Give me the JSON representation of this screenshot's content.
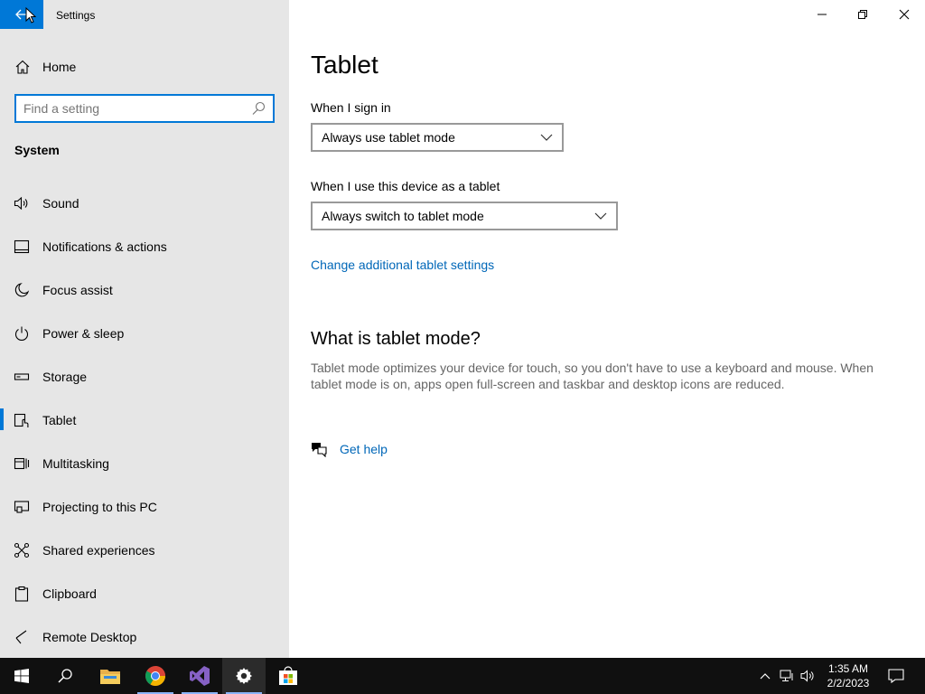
{
  "window": {
    "title": "Settings",
    "controls": [
      "minimize-icon",
      "restore-icon",
      "close-icon"
    ]
  },
  "sidebar": {
    "home_label": "Home",
    "search_placeholder": "Find a setting",
    "section_title": "System",
    "items": [
      {
        "label": "Sound",
        "icon": "speaker-icon"
      },
      {
        "label": "Notifications & actions",
        "icon": "notification-icon"
      },
      {
        "label": "Focus assist",
        "icon": "moon-icon"
      },
      {
        "label": "Power & sleep",
        "icon": "power-icon"
      },
      {
        "label": "Storage",
        "icon": "storage-icon"
      },
      {
        "label": "Tablet",
        "icon": "tablet-icon",
        "selected": true
      },
      {
        "label": "Multitasking",
        "icon": "multitasking-icon"
      },
      {
        "label": "Projecting to this PC",
        "icon": "projecting-icon"
      },
      {
        "label": "Shared experiences",
        "icon": "shared-icon"
      },
      {
        "label": "Clipboard",
        "icon": "clipboard-icon"
      },
      {
        "label": "Remote Desktop",
        "icon": "remote-desktop-icon"
      }
    ]
  },
  "main": {
    "title": "Tablet",
    "sign_in_label": "When I sign in",
    "sign_in_value": "Always use tablet mode",
    "device_label": "When I use this device as a tablet",
    "device_value": "Always switch to tablet mode",
    "additional_link": "Change additional tablet settings",
    "what_heading": "What is tablet mode?",
    "what_desc": "Tablet mode optimizes your device for touch, so you don't have to use a keyboard and mouse. When tablet mode is on, apps open full-screen and taskbar and desktop icons are reduced.",
    "help_link": "Get help"
  },
  "taskbar": {
    "apps": [
      "start-icon",
      "search-icon",
      "file-explorer-icon",
      "chrome-icon",
      "visual-studio-icon",
      "settings-icon",
      "store-icon"
    ],
    "time": "1:35 AM",
    "date": "2/2/2023"
  },
  "colors": {
    "accent": "#0078d7",
    "link": "#0067b8",
    "sidebar_bg": "#e6e6e6",
    "taskbar_bg": "#101010"
  }
}
